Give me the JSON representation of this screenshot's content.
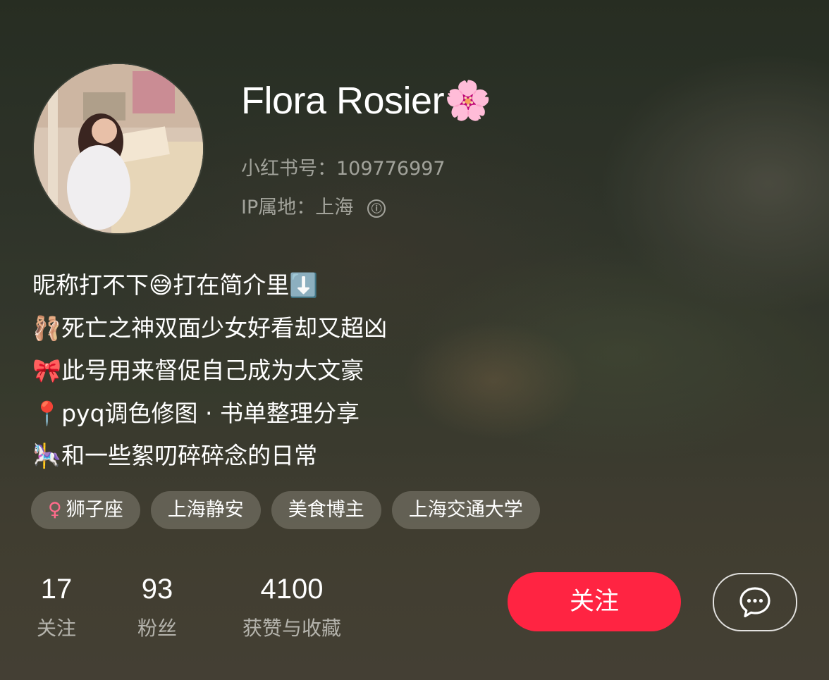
{
  "profile": {
    "username": "Flora Rosier🌸",
    "id_line": "小红书号：109776997",
    "ip_line": "IP属地：上海",
    "info_icon": "ⓘ"
  },
  "bio": {
    "lines": [
      "昵称打不下😅打在简介里⬇️",
      "🩰死亡之神双面少女好看却又超凶",
      "🎀此号用来督促自己成为大文豪",
      "📍pyq调色修图 · 书单整理分享",
      "🎠和一些絮叨碎碎念的日常"
    ]
  },
  "tags": [
    {
      "icon": "♀",
      "label": "狮子座"
    },
    {
      "label": "上海静安"
    },
    {
      "label": "美食博主"
    },
    {
      "label": "上海交通大学"
    }
  ],
  "stats": [
    {
      "value": "17",
      "label": "关注"
    },
    {
      "value": "93",
      "label": "粉丝"
    },
    {
      "value": "4100",
      "label": "获赞与收藏"
    }
  ],
  "actions": {
    "follow_label": "关注",
    "message_icon": "chat-bubble-icon"
  },
  "colors": {
    "accent": "#ff2442",
    "gender_icon": "#ff6b8b"
  }
}
